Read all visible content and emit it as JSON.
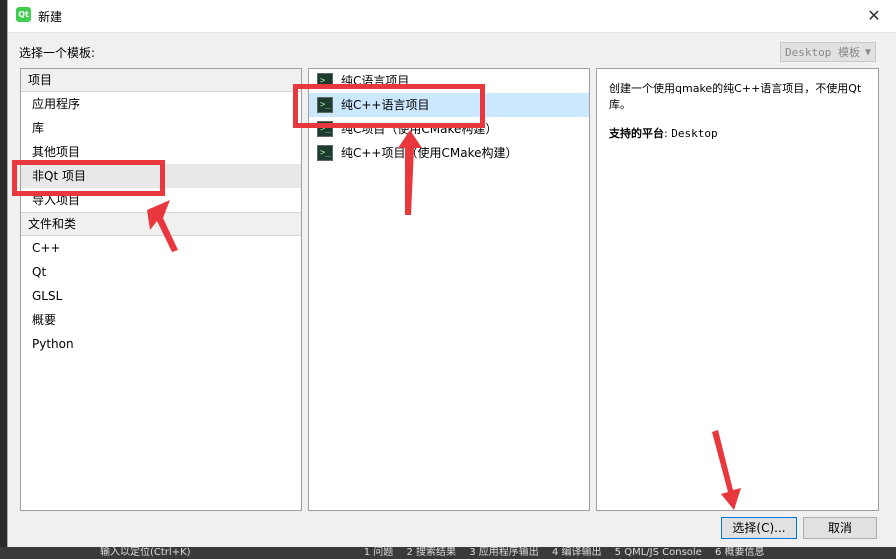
{
  "window": {
    "title": "新建",
    "app_icon_label": "Qt"
  },
  "header": {
    "choose_template": "选择一个模板:",
    "template_filter": "Desktop 模板"
  },
  "categories": [
    {
      "header": "项目",
      "items": [
        "应用程序",
        "库",
        "其他项目",
        "非Qt 项目",
        "导入项目"
      ]
    },
    {
      "header": "文件和类",
      "items": [
        "C++",
        "Qt",
        "GLSL",
        "概要",
        "Python"
      ]
    }
  ],
  "selected_category": "非Qt 项目",
  "projects": [
    "纯C语言项目",
    "纯C++语言项目",
    "纯C项目（使用CMake构建）",
    "纯C++项目（使用CMake构建）"
  ],
  "selected_project": "纯C++语言项目",
  "description": {
    "text": "创建一个使用qmake的纯C++语言项目，不使用Qt库。",
    "platforms_label": "支持的平台",
    "platforms_value": "Desktop"
  },
  "buttons": {
    "choose": "选择(C)...",
    "cancel": "取消"
  },
  "taskbar": [
    "输入以定位(Ctrl+K)",
    "1 问题",
    "2 搜索结果",
    "3 应用程序输出",
    "4 编译输出",
    "5 QML/JS Console",
    "6 概要信息"
  ],
  "colors": {
    "annotation": "#e8383d",
    "selection": "#cce8ff"
  }
}
